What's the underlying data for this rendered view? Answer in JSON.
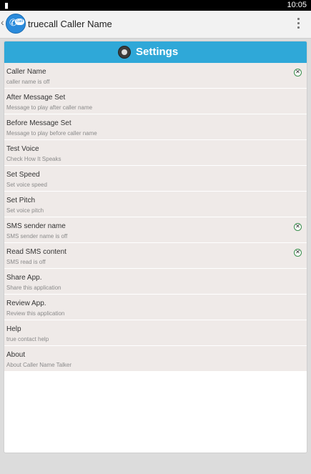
{
  "status_bar": {
    "left_icon": "sim-card-icon",
    "time": "10:05"
  },
  "action_bar": {
    "up_icon": "chevron-left-icon",
    "app_icon": "phone-call-icon",
    "app_icon_badge": "call",
    "title": "truecall Caller Name",
    "overflow_icon": "more-vert-icon"
  },
  "settings_header": {
    "icon": "gear-icon",
    "title": "Settings",
    "color": "#2fa8d8"
  },
  "preferences": [
    {
      "title": "Caller Name",
      "summary": "caller name is off",
      "checkbox": true
    },
    {
      "title": "After Message Set",
      "summary": "Message to play after caller name",
      "checkbox": false
    },
    {
      "title": "Before Message Set",
      "summary": "Message to play before caller name",
      "checkbox": false
    },
    {
      "title": "Test Voice",
      "summary": "Check How It Speaks",
      "checkbox": false
    },
    {
      "title": "Set Speed",
      "summary": "Set voice speed",
      "checkbox": false
    },
    {
      "title": "Set Pitch",
      "summary": "Set voice pitch",
      "checkbox": false
    },
    {
      "title": "SMS sender name",
      "summary": "SMS sender name is off",
      "checkbox": true
    },
    {
      "title": "Read SMS content",
      "summary": "SMS read is off",
      "checkbox": true
    },
    {
      "title": "Share App.",
      "summary": "Share this application",
      "checkbox": false
    },
    {
      "title": "Review App.",
      "summary": "Review this application",
      "checkbox": false
    },
    {
      "title": "Help",
      "summary": "true contact help",
      "checkbox": false
    },
    {
      "title": "About",
      "summary": "About Caller Name Talker",
      "checkbox": false
    }
  ]
}
